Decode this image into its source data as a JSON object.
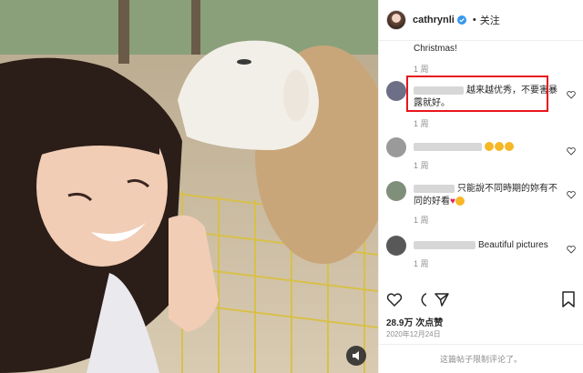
{
  "header": {
    "username": "cathrynli",
    "separator": "•",
    "follow_label": "关注"
  },
  "comments": [
    {
      "text": "Christmas!",
      "time": "1 周"
    },
    {
      "text": "越来越优秀，不要害暴露就好。",
      "time": "1 周"
    },
    {
      "text": "",
      "time": "1 周"
    },
    {
      "text": "只能說不同時期的妳有不同的好看",
      "time": "1 周"
    },
    {
      "text": "Beautiful pictures",
      "time": "1 周"
    }
  ],
  "likes": "28.9万 次点赞",
  "date": "2020年12月24日",
  "footer_notice": "这篇帖子限制评论了。",
  "colors": {
    "highlight": "#e8151b",
    "verified": "#3897f0"
  },
  "icons": [
    "verified-icon",
    "heart-icon",
    "comment-icon",
    "share-icon",
    "bookmark-icon",
    "sound-icon"
  ]
}
